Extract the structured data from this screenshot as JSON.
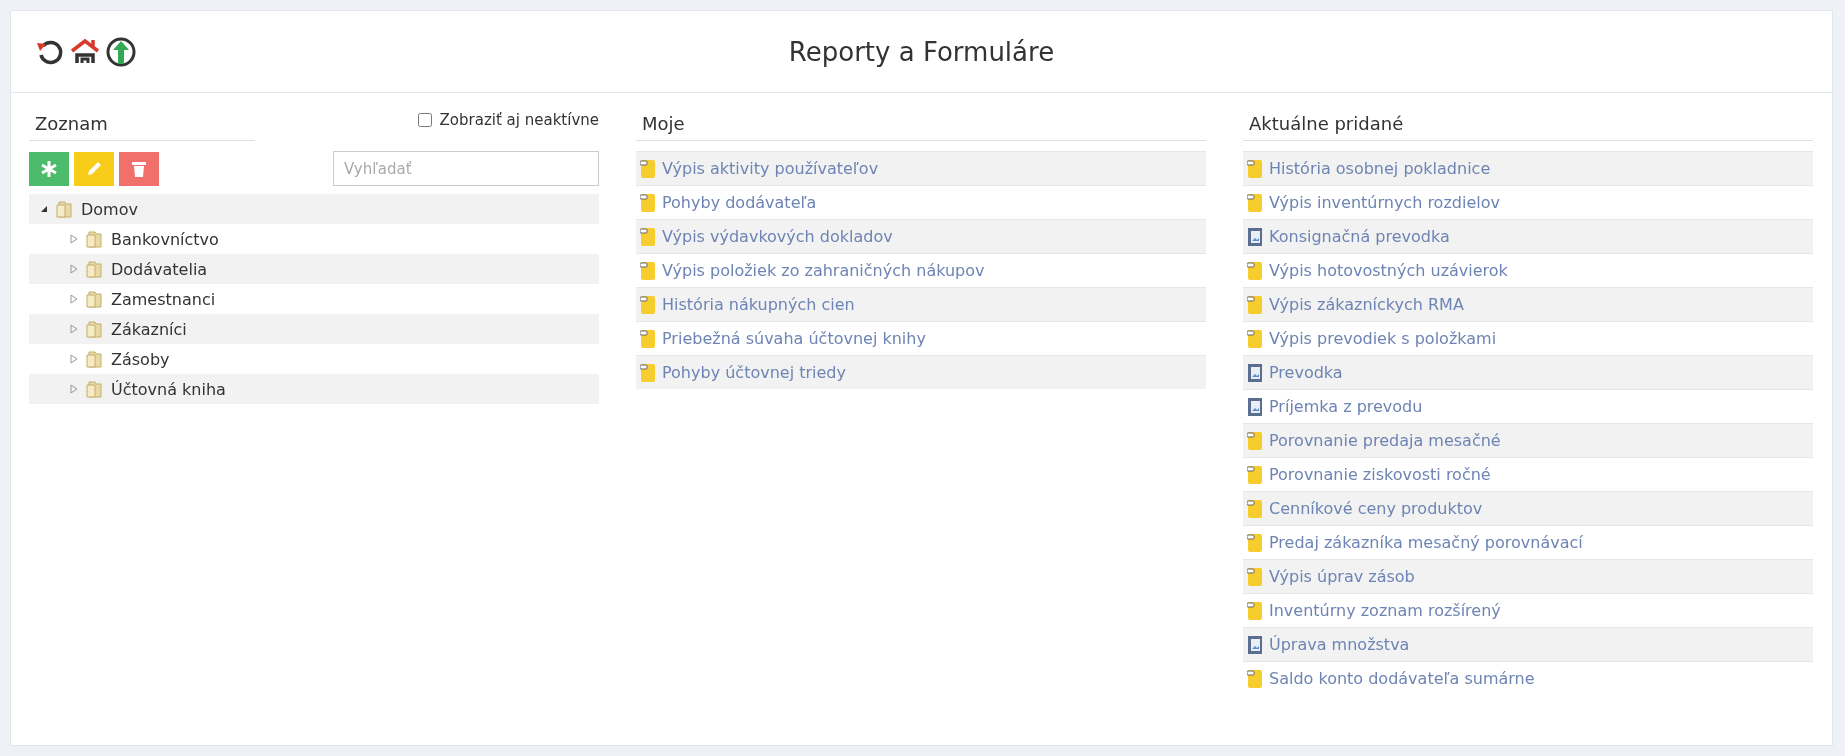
{
  "header": {
    "title": "Reporty a Formuláre"
  },
  "left": {
    "title": "Zoznam",
    "show_inactive": {
      "label": "Zobraziť aj neaktívne",
      "checked": false
    },
    "search": {
      "placeholder": "Vyhľadať"
    },
    "tree": [
      {
        "label": "Domov",
        "expanded": true,
        "children": [
          {
            "label": "Bankovníctvo",
            "expanded": false
          },
          {
            "label": "Dodávatelia",
            "expanded": false
          },
          {
            "label": "Zamestnanci",
            "expanded": false
          },
          {
            "label": "Zákazníci",
            "expanded": false
          },
          {
            "label": "Zásoby",
            "expanded": false
          },
          {
            "label": "Účtovná kniha",
            "expanded": false
          }
        ]
      }
    ]
  },
  "mine": {
    "title": "Moje",
    "items": [
      {
        "label": "Výpis aktivity používateľov",
        "kind": "report"
      },
      {
        "label": "Pohyby dodávateľa",
        "kind": "report"
      },
      {
        "label": "Výpis výdavkových dokladov",
        "kind": "report"
      },
      {
        "label": "Výpis položiek zo zahraničných nákupov",
        "kind": "report"
      },
      {
        "label": "História nákupných cien",
        "kind": "report"
      },
      {
        "label": "Priebežná súvaha účtovnej knihy",
        "kind": "report"
      },
      {
        "label": "Pohyby účtovnej triedy",
        "kind": "report"
      }
    ]
  },
  "recent": {
    "title": "Aktuálne pridané",
    "items": [
      {
        "label": "História osobnej pokladnice",
        "kind": "report"
      },
      {
        "label": "Výpis inventúrnych rozdielov",
        "kind": "report"
      },
      {
        "label": "Konsignačná prevodka",
        "kind": "form"
      },
      {
        "label": "Výpis hotovostných uzávierok",
        "kind": "report"
      },
      {
        "label": "Výpis zákazníckych RMA",
        "kind": "report"
      },
      {
        "label": "Výpis prevodiek s položkami",
        "kind": "report"
      },
      {
        "label": "Prevodka",
        "kind": "form"
      },
      {
        "label": "Príjemka z prevodu",
        "kind": "form"
      },
      {
        "label": "Porovnanie predaja mesačné",
        "kind": "report"
      },
      {
        "label": "Porovnanie ziskovosti ročné",
        "kind": "report"
      },
      {
        "label": "Cenníkové ceny produktov",
        "kind": "report"
      },
      {
        "label": "Predaj zákazníka mesačný porovnávací",
        "kind": "report"
      },
      {
        "label": "Výpis úprav zásob",
        "kind": "report"
      },
      {
        "label": "Inventúrny zoznam rozšírený",
        "kind": "report"
      },
      {
        "label": "Úprava množstva",
        "kind": "form"
      },
      {
        "label": "Saldo konto dodávateľa sumárne",
        "kind": "report"
      }
    ]
  }
}
